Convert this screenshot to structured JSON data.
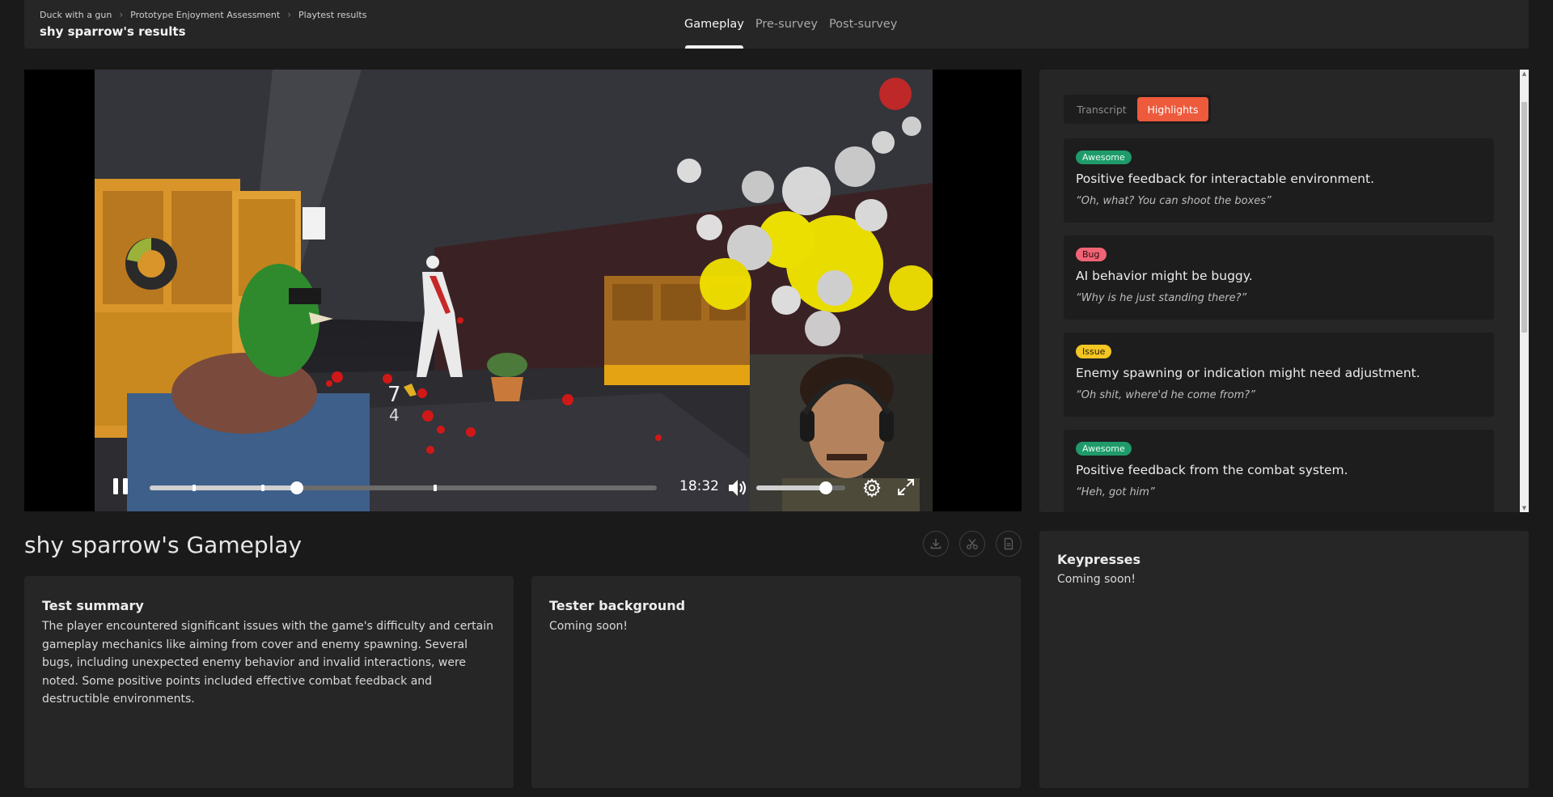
{
  "header": {
    "breadcrumb": [
      "Duck with a gun",
      "Prototype Enjoyment Assessment",
      "Playtest results"
    ],
    "title": "shy sparrow's results",
    "tabs": [
      {
        "label": "Gameplay",
        "active": true
      },
      {
        "label": "Pre-survey",
        "active": false
      },
      {
        "label": "Post-survey",
        "active": false
      }
    ]
  },
  "player": {
    "time": "18:32",
    "progress": 0.29,
    "markers": [
      0.085,
      0.22,
      0.56
    ],
    "volume": 0.78,
    "hud_ammo_current": "7",
    "hud_ammo_total": "4",
    "icons": [
      "pause-icon",
      "volume-icon",
      "settings-gear-icon",
      "fullscreen-icon"
    ]
  },
  "highlights": {
    "tabs": [
      "Transcript",
      "Highlights"
    ],
    "active_tab": "Highlights",
    "items": [
      {
        "tag": "Awesome",
        "tag_color": "#1f9a6a",
        "title": "Positive feedback for interactable environment.",
        "quote": "“Oh, what? You can shoot the boxes”"
      },
      {
        "tag": "Bug",
        "tag_color": "#f06475",
        "title": "AI behavior might be buggy.",
        "quote": "“Why is he just standing there?”"
      },
      {
        "tag": "Issue",
        "tag_color": "#f3c623",
        "title": "Enemy spawning or indication might need adjustment.",
        "quote": "“Oh shit, where'd he come from?”"
      },
      {
        "tag": "Awesome",
        "tag_color": "#1f9a6a",
        "title": "Positive feedback from the combat system.",
        "quote": "“Heh, got him”"
      }
    ]
  },
  "gameplay": {
    "title": "shy sparrow's Gameplay",
    "actions": [
      "download-icon",
      "scissors-icon",
      "document-icon"
    ]
  },
  "cards": {
    "summary": {
      "title": "Test summary",
      "text": "The player encountered significant issues with the game's difficulty and certain gameplay mechanics like aiming from cover and enemy spawning. Several bugs, including unexpected enemy behavior and invalid interactions, were noted. Some positive points included effective combat feedback and destructible environments."
    },
    "background": {
      "title": "Tester background",
      "text": "Coming soon!"
    },
    "keypresses": {
      "title": "Keypresses",
      "text": "Coming soon!"
    }
  },
  "colors": {
    "accent": "#ee5a3c",
    "awesome": "#1f9a6a",
    "bug": "#f06475",
    "issue": "#f3c623"
  }
}
